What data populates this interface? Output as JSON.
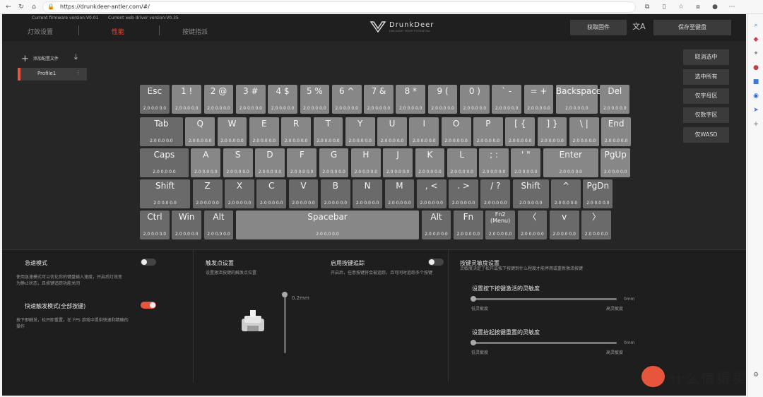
{
  "browser": {
    "url": "https://drunkdeer-antler.com/#/"
  },
  "header": {
    "firmware_version": "Current firmware version:V0.01",
    "driver_version": "Current web driver version:V0.35",
    "nav": [
      {
        "label": "灯效设置"
      },
      {
        "label": "性能"
      },
      {
        "label": "按键指派"
      }
    ],
    "logo_text": "DrunkDeer",
    "logo_tagline": "UNLEASH YOUR POTENTIAL",
    "get_firmware": "获取固件",
    "save_to_keyboard": "保存至键盘"
  },
  "profiles": {
    "add_label": "添加配置文件",
    "items": [
      {
        "name": "Profile1"
      }
    ]
  },
  "keys": {
    "row1": [
      {
        "label": "Esc",
        "value": "2.0  0.0  0.0"
      },
      {
        "label": "1 !",
        "value": "2.0  0.0  0.0"
      },
      {
        "label": "2 @",
        "value": "2.0  0.0  0.0"
      },
      {
        "label": "3 #",
        "value": "2.0  0.0  0.0"
      },
      {
        "label": "4 $",
        "value": "2.0  0.0  0.0"
      },
      {
        "label": "5 %",
        "value": "2.0  0.0  0.0"
      },
      {
        "label": "6 ^",
        "value": "2.0  0.0  0.0"
      },
      {
        "label": "7 &",
        "value": "2.0  0.0  0.0"
      },
      {
        "label": "8 *",
        "value": "2.0  0.0  0.0"
      },
      {
        "label": "9 (",
        "value": "2.0  0.0  0.0"
      },
      {
        "label": "0 )",
        "value": "2.0  0.0  0.0"
      },
      {
        "label": "` -",
        "value": "2.0  0.0  0.0"
      },
      {
        "label": "= +",
        "value": "2.0  0.0  0.0"
      },
      {
        "label": "Backspace",
        "value": "2.0  0.0  0.0"
      },
      {
        "label": "Del",
        "value": "2.0  0.0  0.0"
      }
    ],
    "row2": [
      {
        "label": "Tab",
        "value": "2.0  0.0  0.0"
      },
      {
        "label": "Q",
        "value": "2.0  0.0  0.0"
      },
      {
        "label": "W",
        "value": "2.0  0.0  0.0"
      },
      {
        "label": "E",
        "value": "2.0  0.0  0.0"
      },
      {
        "label": "R",
        "value": "2.0  0.0  0.0"
      },
      {
        "label": "T",
        "value": "2.0  0.0  0.0"
      },
      {
        "label": "Y",
        "value": "2.0  0.0  0.0"
      },
      {
        "label": "U",
        "value": "2.0  0.0  0.0"
      },
      {
        "label": "I",
        "value": "2.0  0.0  0.0"
      },
      {
        "label": "O",
        "value": "2.0  0.0  0.0"
      },
      {
        "label": "P",
        "value": "2.0  0.0  0.0"
      },
      {
        "label": "[ {",
        "value": "2.0  0.0  0.0"
      },
      {
        "label": "] }",
        "value": "2.0  0.0  0.0"
      },
      {
        "label": "\\ |",
        "value": "2.0  0.0  0.0"
      },
      {
        "label": "End",
        "value": "2.0  0.0  0.0"
      }
    ],
    "row3": [
      {
        "label": "Caps",
        "value": "2.0  0.0  0.0"
      },
      {
        "label": "A",
        "value": "2.0  0.0  0.0"
      },
      {
        "label": "S",
        "value": "2.0  0.0  0.0"
      },
      {
        "label": "D",
        "value": "2.0  0.0  0.0"
      },
      {
        "label": "F",
        "value": "2.0  0.0  0.0"
      },
      {
        "label": "G",
        "value": "2.0  0.0  0.0"
      },
      {
        "label": "H",
        "value": "2.0  0.0  0.0"
      },
      {
        "label": "J",
        "value": "2.0  0.0  0.0"
      },
      {
        "label": "K",
        "value": "2.0  0.0  0.0"
      },
      {
        "label": "L",
        "value": "2.0  0.0  0.0"
      },
      {
        "label": "; :",
        "value": "2.0  0.0  0.0"
      },
      {
        "label": "' \"",
        "value": "2.0  0.0  0.0"
      },
      {
        "label": "Enter",
        "value": "2.0  0.0  0.0"
      },
      {
        "label": "PgUp",
        "value": "2.0  0.0  0.0"
      }
    ],
    "row4": [
      {
        "label": "Shift",
        "value": "2.0  0.0  0.0"
      },
      {
        "label": "Z",
        "value": "2.0  0.0  0.0"
      },
      {
        "label": "X",
        "value": "2.0  0.0  0.0"
      },
      {
        "label": "C",
        "value": "2.0  0.0  0.0"
      },
      {
        "label": "V",
        "value": "2.0  0.0  0.0"
      },
      {
        "label": "B",
        "value": "2.0  0.0  0.0"
      },
      {
        "label": "N",
        "value": "2.0  0.0  0.0"
      },
      {
        "label": "M",
        "value": "2.0  0.0  0.0"
      },
      {
        "label": ", <",
        "value": "2.0  0.0  0.0"
      },
      {
        "label": ". >",
        "value": "2.0  0.0  0.0"
      },
      {
        "label": "/ ?",
        "value": "2.0  0.0  0.0"
      },
      {
        "label": "Shift",
        "value": "2.0  0.0  0.0"
      },
      {
        "label": "^",
        "value": "2.0  0.0  0.0"
      },
      {
        "label": "PgDn",
        "value": "2.0  0.0  0.0"
      }
    ],
    "row5": [
      {
        "label": "Ctrl",
        "value": "2.0  0.0  0.0"
      },
      {
        "label": "Win",
        "value": "2.0  0.0  0.0"
      },
      {
        "label": "Alt",
        "value": "2.0  0.0  0.0"
      },
      {
        "label": "Spacebar",
        "value": "2.0  0.0  0.0"
      },
      {
        "label": "Alt",
        "value": "2.0  0.0  0.0"
      },
      {
        "label": "Fn",
        "value": "2.0  0.0  0.0"
      },
      {
        "label": "Fn2\n(Menu)",
        "value": "2.0  0.0  0.0"
      },
      {
        "label": "〈",
        "value": "2.0  0.0  0.0"
      },
      {
        "label": "v",
        "value": "2.0  0.0  0.0"
      },
      {
        "label": "〉",
        "value": "2.0  0.0  0.0"
      }
    ]
  },
  "selection_buttons": [
    {
      "label": "取消选中"
    },
    {
      "label": "选中所有"
    },
    {
      "label": "仅字母区"
    },
    {
      "label": "仅数字区"
    },
    {
      "label": "仅WASD"
    }
  ],
  "rapid_mode": {
    "title": "急速模式",
    "desc": "使用急速模式可以优化你的键盘输入速度，开启后灯效变为静止状态，且按键追踪功能关闭",
    "enabled": false
  },
  "rapid_trigger": {
    "title": "快速触发模式(全部按键)",
    "desc": "按下即触发，松开即重置。在 FPS 游戏中提供快速和精确的操作",
    "enabled": true
  },
  "actuation": {
    "title": "触发点设置",
    "desc": "设置激活按键的触发点位置",
    "value": "0.2mm"
  },
  "tracking": {
    "title": "启用按键追踪",
    "desc": "开启后，任意按键将会被追踪，且可同时追踪多个按键",
    "enabled": false
  },
  "sensitivity": {
    "title": "按键灵敏度设置",
    "desc": "灵敏度决定了松开或按下按键到什么程度才能停用或重新激活按键",
    "press_title": "设置按下按键激活的灵敏度",
    "press_value": "0mm",
    "press_low": "低灵敏度",
    "press_high": "高灵敏度",
    "release_title": "设置抬起按键重置的灵敏度",
    "release_value": "0mm",
    "release_low": "低灵敏度",
    "release_high": "高灵敏度"
  },
  "watermark": {
    "text": "什么值得买"
  },
  "colors": {
    "accent": "#e8553d",
    "key": "#7d7d7d",
    "panel": "#262626"
  }
}
